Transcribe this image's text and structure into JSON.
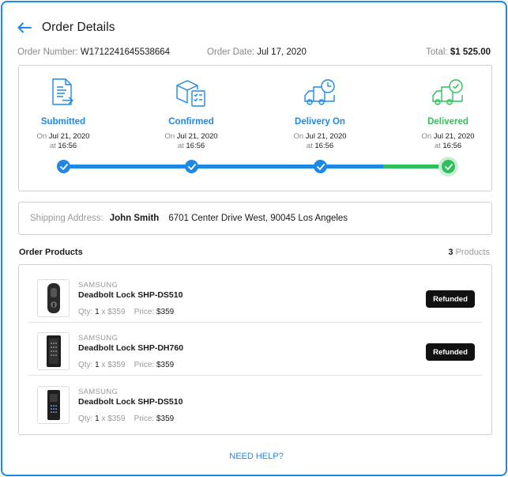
{
  "page": {
    "title": "Order Details"
  },
  "order": {
    "number_label": "Order Number:",
    "number": "W1712241645538664",
    "date_label": "Order Date:",
    "date": "Jul 17, 2020",
    "total_label": "Total:",
    "total": "$1 525.00"
  },
  "tracking": {
    "steps": [
      {
        "label": "Submitted",
        "on": "On",
        "date": "Jul 21, 2020",
        "at": "at",
        "time": "16:56",
        "icon": "document-icon"
      },
      {
        "label": "Confirmed",
        "on": "On",
        "date": "Jul 21, 2020",
        "at": "at",
        "time": "16:56",
        "icon": "box-checklist-icon"
      },
      {
        "label": "Delivery On",
        "on": "On",
        "date": "Jul 21, 2020",
        "at": "at",
        "time": "16:56",
        "icon": "truck-clock-icon"
      },
      {
        "label": "Delivered",
        "on": "On",
        "date": "Jul 21, 2020",
        "at": "at",
        "time": "16:56",
        "icon": "truck-check-icon"
      }
    ],
    "progress": 1.0
  },
  "shipping": {
    "label": "Shipping Address:",
    "name": "John Smith",
    "address": "6701 Center Drive West, 90045 Los Angeles"
  },
  "products": {
    "title": "Order Products",
    "count": "3",
    "count_label": "Products",
    "items": [
      {
        "brand": "SAMSUNG",
        "name": "Deadbolt Lock SHP-DS510",
        "qty_label": "Qty:",
        "qty": "1",
        "x": "x",
        "unit": "$359",
        "price_label": "Price:",
        "price": "$359",
        "status": "Refunded"
      },
      {
        "brand": "SAMSUNG",
        "name": "Deadbolt Lock SHP-DH760",
        "qty_label": "Qty:",
        "qty": "1",
        "x": "x",
        "unit": "$359",
        "price_label": "Price:",
        "price": "$359",
        "status": "Refunded"
      },
      {
        "brand": "SAMSUNG",
        "name": "Deadbolt Lock SHP-DS510",
        "qty_label": "Qty:",
        "qty": "1",
        "x": "x",
        "unit": "$359",
        "price_label": "Price:",
        "price": "$359",
        "status": ""
      }
    ]
  },
  "help": {
    "label": "NEED HELP?"
  },
  "colors": {
    "accent": "#1e88e5",
    "success": "#2dbf5a",
    "badge": "#111111"
  }
}
